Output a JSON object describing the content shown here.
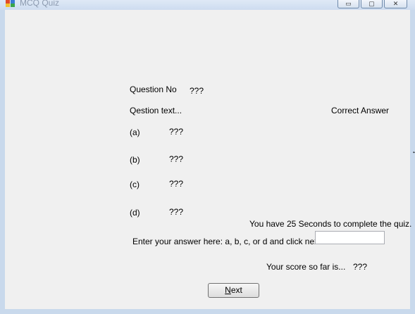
{
  "window": {
    "title": "MCQ Quiz",
    "controls": {
      "minimize": "▭",
      "maximize": "▢",
      "close": "✕"
    }
  },
  "quiz": {
    "question_no_label": "Question No",
    "question_no_value": "???",
    "question_text": "Qestion text...",
    "correct_answer_label": "Correct Answer",
    "options": [
      {
        "letter": "(a)",
        "text": "???"
      },
      {
        "letter": "(b)",
        "text": "???"
      },
      {
        "letter": "(c)",
        "text": "???"
      },
      {
        "letter": "(d)",
        "text": "???"
      }
    ],
    "timer_text": "You have 25 Seconds to complete the quiz.",
    "answer_prompt": "Enter your answer here: a, b, c, or d and click next.",
    "answer_value": "",
    "score_label": "Your score so far is...",
    "score_value": "???",
    "next_button": {
      "mnemonic": "N",
      "rest": "ext"
    }
  },
  "colors": {
    "client_bg": "#f0f0f0",
    "frame": "#c9d9ec"
  },
  "icons": {
    "app": "app-window-icon",
    "cursor": "resize-cursor-icon"
  }
}
